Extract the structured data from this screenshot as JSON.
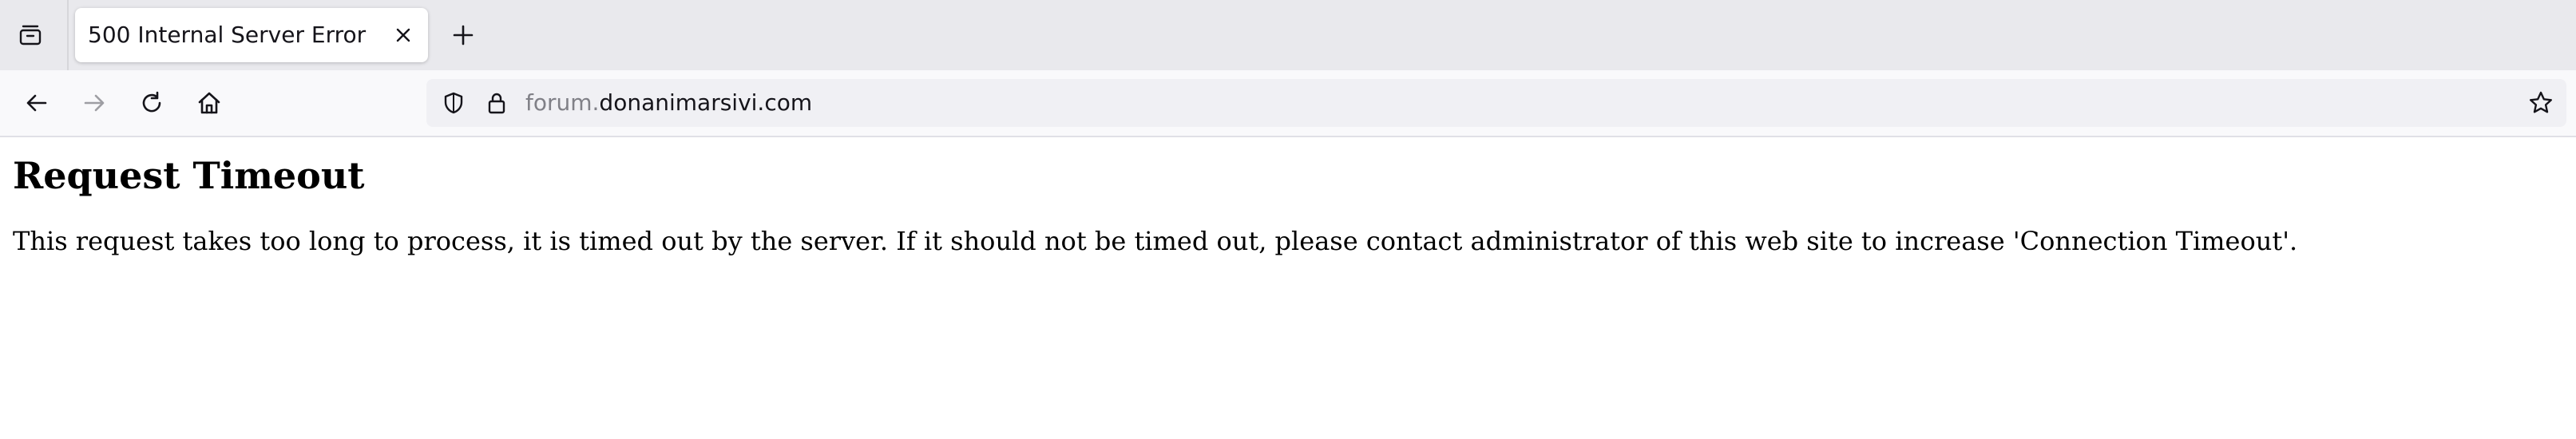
{
  "browser": {
    "tab": {
      "title": "500 Internal Server Error"
    },
    "url": {
      "subdomain": "forum.",
      "domain": "donanimarsivi.com"
    },
    "icons": {
      "tab_list": "tab-list-icon",
      "close": "close-icon",
      "new_tab": "plus-icon",
      "back": "arrow-left-icon",
      "forward": "arrow-right-icon",
      "reload": "reload-icon",
      "home": "home-icon",
      "shield": "shield-icon",
      "lock": "lock-icon",
      "bookmark": "star-icon"
    }
  },
  "page": {
    "heading": "Request Timeout",
    "message": "This request takes too long to process, it is timed out by the server. If it should not be timed out, please contact administrator of this web site to increase 'Connection Timeout'."
  },
  "colors": {
    "tabstrip_bg": "#e9e9ed",
    "navbar_bg": "#f9f9fb",
    "urlbar_bg": "#f0f0f4",
    "text_primary": "#15141a",
    "text_muted": "#808087",
    "icon_disabled": "#9e9ea3"
  }
}
